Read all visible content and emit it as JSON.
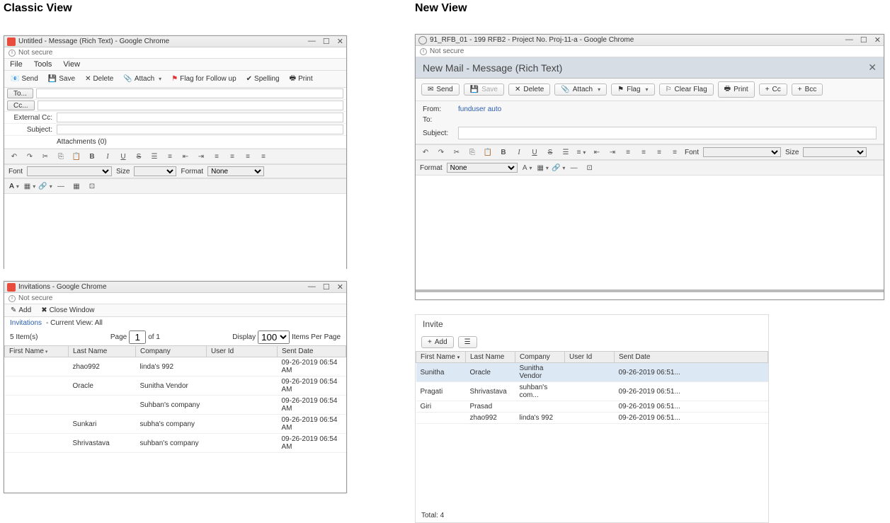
{
  "headings": {
    "classic": "Classic View",
    "new": "New View"
  },
  "classic_msg": {
    "title": "Untitled - Message (Rich Text) - Google Chrome",
    "not_secure": "Not secure",
    "menus": [
      "File",
      "Tools",
      "View"
    ],
    "toolbar": {
      "send": "Send",
      "save": "Save",
      "delete": "Delete",
      "attach": "Attach",
      "flag": "Flag for Follow up",
      "spelling": "Spelling",
      "print": "Print"
    },
    "fields": {
      "to": "To...",
      "cc": "Cc...",
      "extcc": "External Cc:",
      "subject": "Subject:",
      "attachments": "Attachments (0)"
    },
    "font_label": "Font",
    "size_label": "Size",
    "format_label": "Format",
    "format_value": "None"
  },
  "classic_inv": {
    "title": "Invitations - Google Chrome",
    "not_secure": "Not secure",
    "add": "Add",
    "close": "Close Window",
    "breadcrumb_a": "Invitations",
    "breadcrumb_b": "- Current View:  All",
    "items": "5  Item(s)",
    "page": "Page",
    "page_val": "1",
    "of": "of  1",
    "display": "Display",
    "perpage": "100",
    "itemsperpage": "Items Per Page",
    "cols": {
      "first": "First Name",
      "last": "Last Name",
      "company": "Company",
      "userid": "User Id",
      "sent": "Sent Date"
    },
    "rows": [
      {
        "first": "",
        "last": "zhao992",
        "company": "linda's 992",
        "userid": "",
        "sent": "09-26-2019 06:54 AM"
      },
      {
        "first": "",
        "last": "Oracle",
        "company": "Sunitha Vendor",
        "userid": "",
        "sent": "09-26-2019 06:54 AM"
      },
      {
        "first": "",
        "last": "",
        "company": "Suhban's company",
        "userid": "",
        "sent": "09-26-2019 06:54 AM"
      },
      {
        "first": "",
        "last": "Sunkari",
        "company": "subha's company",
        "userid": "",
        "sent": "09-26-2019 06:54 AM"
      },
      {
        "first": "",
        "last": "Shrivastava",
        "company": "suhban's company",
        "userid": "",
        "sent": "09-26-2019 06:54 AM"
      }
    ]
  },
  "new_msg": {
    "title": "91_RFB_01 - 199 RFB2 - Project No. Proj-11-a - Google Chrome",
    "not_secure": "Not secure",
    "header": "New Mail - Message (Rich Text)",
    "toolbar": {
      "send": "Send",
      "save": "Save",
      "delete": "Delete",
      "attach": "Attach",
      "flag": "Flag",
      "clear": "Clear Flag",
      "print": "Print",
      "cc": "Cc",
      "bcc": "Bcc"
    },
    "from_label": "From:",
    "from_value": "funduser auto",
    "to_label": "To:",
    "subject_label": "Subject:",
    "font_label": "Font",
    "size_label": "Size",
    "format_label": "Format",
    "format_value": "None"
  },
  "new_inv": {
    "header": "Invite",
    "add": "Add",
    "cols": {
      "first": "First Name",
      "last": "Last Name",
      "company": "Company",
      "userid": "User Id",
      "sent": "Sent Date"
    },
    "rows": [
      {
        "first": "Sunitha",
        "last": "Oracle",
        "company": "Sunitha Vendor",
        "userid": "",
        "sent": "09-26-2019 06:51..."
      },
      {
        "first": "Pragati",
        "last": "Shrivastava",
        "company": "suhban's com...",
        "userid": "",
        "sent": "09-26-2019 06:51..."
      },
      {
        "first": "Giri",
        "last": "Prasad",
        "company": "",
        "userid": "",
        "sent": "09-26-2019 06:51..."
      },
      {
        "first": "",
        "last": "zhao992",
        "company": "linda's 992",
        "userid": "",
        "sent": "09-26-2019 06:51..."
      }
    ],
    "total": "Total: 4"
  }
}
